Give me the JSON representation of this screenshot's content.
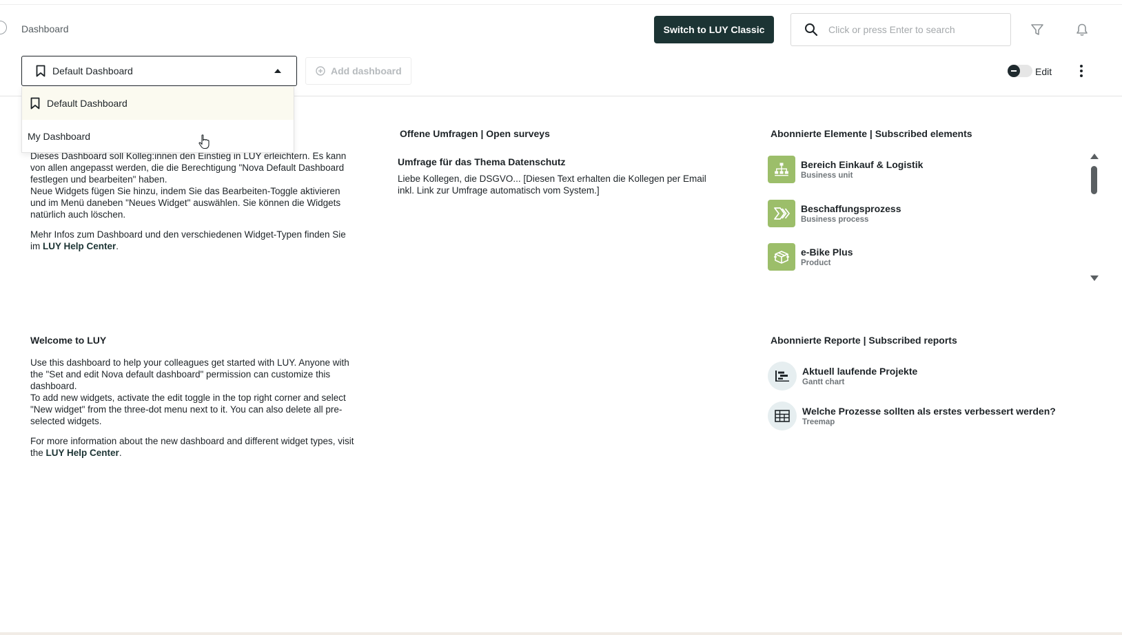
{
  "header": {
    "breadcrumb": "Dashboard",
    "switch_button": "Switch to LUY Classic",
    "search_placeholder": "Click or press Enter to search"
  },
  "toolbar": {
    "selected_dashboard": "Default Dashboard",
    "add_dashboard": "Add dashboard",
    "edit_label": "Edit"
  },
  "dropdown": {
    "items": [
      {
        "label": "Default Dashboard"
      },
      {
        "label": "My Dashboard"
      }
    ]
  },
  "welcome_de": {
    "p1": "Dieses Dashboard soll Kolleg:innen den Einstieg in LUY erleichtern. Es kann von allen angepasst werden, die die Berechtigung \"Nova Default Dashboard festlegen und bearbeiten\" haben.",
    "p2": "Neue Widgets fügen Sie hinzu, indem Sie das Bearbeiten-Toggle aktivieren und im Menü daneben \"Neues Widget\" auswählen. Sie können die Widgets natürlich auch löschen.",
    "p3_pre": "Mehr Infos zum Dashboard und den verschiedenen Widget-Typen finden Sie im ",
    "p3_link": "LUY Help Center",
    "p3_post": "."
  },
  "surveys": {
    "title": "Offene Umfragen | Open surveys",
    "item_title": "Umfrage für das Thema Datenschutz",
    "item_text": "Liebe Kollegen, die DSGVO... [Diesen Text erhalten die Kollegen per Email inkl. Link zur Umfrage automatisch vom System.]"
  },
  "subscribed_elements": {
    "title": "Abonnierte Elemente | Subscribed elements",
    "items": [
      {
        "name": "Bereich Einkauf & Logistik",
        "type": "Business unit",
        "icon": "org-chart-icon"
      },
      {
        "name": "Beschaffungsprozess",
        "type": "Business process",
        "icon": "process-chevron-icon"
      },
      {
        "name": "e-Bike Plus",
        "type": "Product",
        "icon": "product-box-icon"
      }
    ]
  },
  "welcome_en": {
    "title": "Welcome to LUY",
    "p1": "Use this dashboard to help your colleagues get started with LUY. Anyone with the \"Set and edit Nova default dashboard\" permission can customize this dashboard.",
    "p2": "To add new widgets, activate the edit toggle in the top right corner and select \"New widget\" from the three-dot menu next to it. You can also delete all pre-selected widgets.",
    "p3_pre": "For more information about the new dashboard and different widget types, visit the ",
    "p3_link": "LUY Help Center",
    "p3_post": "."
  },
  "subscribed_reports": {
    "title": "Abonnierte Reporte | Subscribed reports",
    "items": [
      {
        "name": "Aktuell laufende Projekte",
        "type": "Gantt chart",
        "icon": "gantt-icon"
      },
      {
        "name": "Welche Prozesse sollten als erstes verbessert werden?",
        "type": "Treemap",
        "icon": "treemap-icon"
      }
    ]
  },
  "colors": {
    "accent_dark": "#1c3434",
    "element_icon_bg": "#9cbe6a",
    "report_icon_bg": "#e6eef0",
    "dropdown_active_bg": "#fbfaf0"
  }
}
